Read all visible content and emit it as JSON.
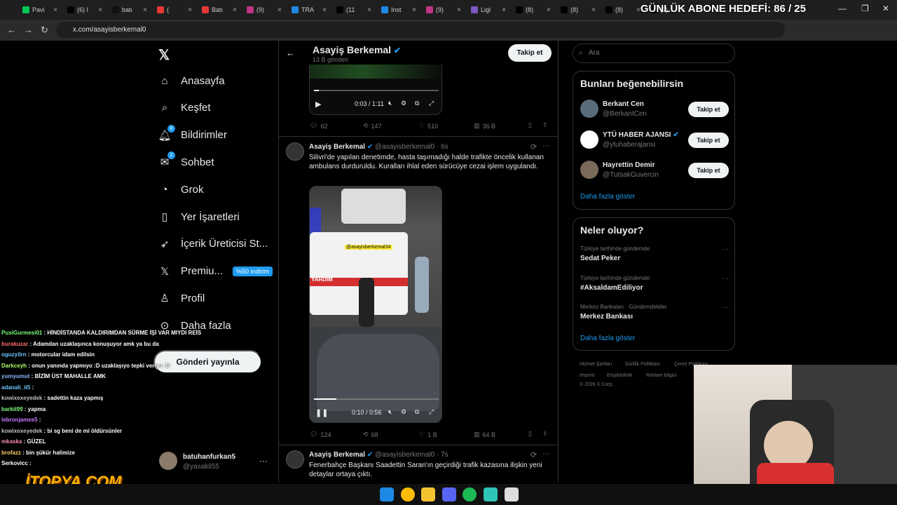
{
  "browser": {
    "tabs": [
      {
        "label": "Pavi",
        "color": "#00c853"
      },
      {
        "label": "(6) I",
        "color": "#000000"
      },
      {
        "label": "batı",
        "color": "#111111"
      },
      {
        "label": "(",
        "color": "#e53935"
      },
      {
        "label": "Batı",
        "color": "#e53935"
      },
      {
        "label": "(9)",
        "color": "#c13584"
      },
      {
        "label": "TRA",
        "color": "#1e88e5"
      },
      {
        "label": "(11",
        "color": "#000000"
      },
      {
        "label": "Inst",
        "color": "#1e88e5"
      },
      {
        "label": "(9)",
        "color": "#c13584"
      },
      {
        "label": "Ligl",
        "color": "#7e57c2"
      },
      {
        "label": "(8)",
        "color": "#000000"
      },
      {
        "label": "(8)",
        "color": "#000000"
      },
      {
        "label": "(8)",
        "color": "#000000"
      },
      {
        "label": "(9)",
        "color": "#000000"
      }
    ],
    "url": "x.com/asayisberkemal0",
    "goal_text": "GÜNLÜK ABONE HEDEFİ: 86 / 25"
  },
  "nav": {
    "items": [
      {
        "label": "Anasayfa",
        "icon": "home-icon"
      },
      {
        "label": "Keşfet",
        "icon": "search-icon"
      },
      {
        "label": "Bildirimler",
        "icon": "bell-icon",
        "badge": "8"
      },
      {
        "label": "Sohbet",
        "icon": "chat-icon",
        "badge": "2"
      },
      {
        "label": "Grok",
        "icon": "grok-icon"
      },
      {
        "label": "Yer İşaretleri",
        "icon": "bookmark-icon"
      },
      {
        "label": "İçerik Üreticisi St...",
        "icon": "rocket-icon"
      },
      {
        "label": "Premiu...",
        "icon": "x-logo-icon",
        "promo": "%50 indirim"
      },
      {
        "label": "Profil",
        "icon": "person-icon"
      },
      {
        "label": "Daha fazla",
        "icon": "more-icon"
      }
    ],
    "post_button": "Gönderi yayınla",
    "account": {
      "name": "batuhanfurkan5",
      "handle": "@yasakli55"
    }
  },
  "profile_header": {
    "name": "Asayiş Berkemal",
    "posts_count": "13 B gönderi",
    "follow": "Takip et"
  },
  "tweets": [
    {
      "video_time": "0:03 / 1:11",
      "video_progress": 0.04,
      "stats": {
        "replies": "62",
        "retweets": "147",
        "likes": "510",
        "views": "36 B"
      }
    },
    {
      "author": "Asayiş Berkemal",
      "handle": "@asayisberkemal0",
      "time": "· 6s",
      "text": "Silivri'de yapılan denetimde, hasta taşımadığı halde trafikte öncelik kullanan ambulans durduruldu. Kuralları ihlal eden sürücüye cezai işlem uygulandı.",
      "watermark": "@asayisberkemal34",
      "ambulance_text": "YARDIM",
      "video_time": "0:10 / 0:56",
      "video_progress": 0.18,
      "stats": {
        "replies": "124",
        "retweets": "68",
        "likes": "1 B",
        "views": "64 B"
      }
    },
    {
      "author": "Asayiş Berkemal",
      "handle": "@asayisberkemal0",
      "time": "· 7s",
      "text": "Fenerbahçe Başkanı Saadettin Saran'ın geçirdiği trafik kazasına ilişkin yeni detaylar ortaya çıktı."
    }
  ],
  "sidebar": {
    "search_placeholder": "Ara",
    "who_title": "Bunları beğenebilirsin",
    "who": [
      {
        "name": "Berkant Cen",
        "handle": "@BerkantCen",
        "follow": "Takip et",
        "avatar_color": "#5a6b7a",
        "verified": false
      },
      {
        "name": "YTÜ HABER AJANSI",
        "handle": "@ytuhaberajansi",
        "follow": "Takip et",
        "avatar_color": "#ffffff",
        "verified": true
      },
      {
        "name": "Hayrettin Demir",
        "handle": "@TutsakGuvercin",
        "follow": "Takip et",
        "avatar_color": "#7a6a5a",
        "verified": false
      }
    ],
    "who_more": "Daha fazla göster",
    "trends_title": "Neler oluyor?",
    "trends": [
      {
        "context": "Türkiye tarihinde gündemde",
        "title": "Sedat Peker"
      },
      {
        "context": "Türkiye tarihinde gündemde",
        "title": "#AksaldamEdiliyor"
      },
      {
        "context": "Merkez Bankaları · Gündemdekiler",
        "title": "Merkez Bankası"
      }
    ],
    "trends_more": "Daha fazla göster",
    "footer": [
      "Hizmet Şartları",
      "Gizlilik Politikası",
      "Çerez Politikası",
      "Imprint",
      "Erişilebilirlik",
      "Reklam bilgisi",
      "© 2026 X Corp."
    ]
  },
  "chat": [
    {
      "user": "PusiGurmesi01",
      "color": "#7cfc7c",
      "msg": "HİNDİSTANDA KALDIRIMDAN SÜRME İŞİ VAR MIYDI REİS"
    },
    {
      "user": "burakuzar",
      "color": "#ff6b6b",
      "msg": "Adamdan uzaklaşınca konuşuyor amk ya bu da"
    },
    {
      "user": "oguzyilrn",
      "color": "#6ec6ff",
      "msg": "motorcular idam edilsin"
    },
    {
      "user": "Darkceyh",
      "color": "#b0ff70",
      "msg": "onun yanında yapmıyo :D uzaklaşıyo tepki veriyo :D"
    },
    {
      "user": "yumyumut",
      "color": "#8ab4ff",
      "msg": "BİZİM ÜST MAHALLE AMK"
    },
    {
      "user": "adanali_it5",
      "color": "#6ec6ff",
      "msg": ""
    },
    {
      "user": "kowixexeyedek",
      "color": "#c0c0c0",
      "msg": "sadettin kaza yapmış"
    },
    {
      "user": "barkit99",
      "color": "#7cfc7c",
      "msg": "yapma"
    },
    {
      "user": "lebronjames5",
      "color": "#c77dff",
      "msg": ""
    },
    {
      "user": "kowixexeyedek",
      "color": "#c0c0c0",
      "msg": "bi sg beni de mi öldürsünler"
    },
    {
      "user": "mkaska",
      "color": "#ff8fab",
      "msg": "GÜZEL"
    },
    {
      "user": "brofazz",
      "color": "#ffd166",
      "msg": "bin şükür halimize"
    },
    {
      "user": "Serkovicc",
      "color": "#ffffff",
      "msg": ""
    }
  ],
  "sponsor": "İTOPYA.COM"
}
